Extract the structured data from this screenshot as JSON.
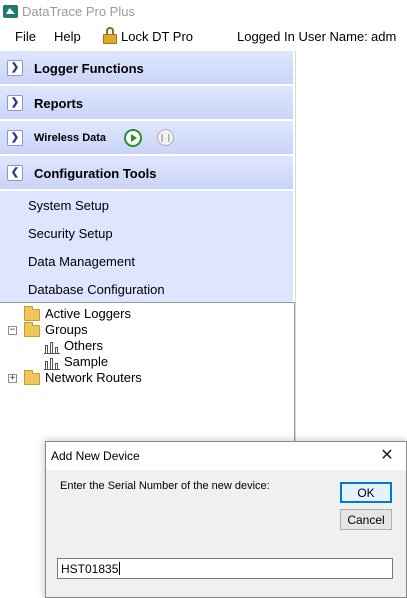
{
  "app": {
    "title": "DataTrace Pro Plus"
  },
  "menubar": {
    "file": "File",
    "help": "Help",
    "lock": "Lock DT Pro",
    "user_label": "Logged In User Name:",
    "user_value": "adm"
  },
  "sidebar": {
    "sections": [
      {
        "label": "Logger Functions",
        "icon": "chevron-double-down-icon"
      },
      {
        "label": "Reports",
        "icon": "chevron-double-down-icon"
      },
      {
        "label": "Wireless Data",
        "icon": "chevron-double-down-icon"
      },
      {
        "label": "Configuration Tools",
        "icon": "chevron-double-up-icon"
      }
    ],
    "config_items": [
      "System Setup",
      "Security Setup",
      "Data Management",
      "Database Configuration"
    ]
  },
  "tree": {
    "nodes": [
      {
        "label": "Active Loggers",
        "icon": "folder-icon"
      },
      {
        "label": "Groups",
        "icon": "folder-icon",
        "expander": "−"
      },
      {
        "label": "Others",
        "icon": "group-icon"
      },
      {
        "label": "Sample",
        "icon": "group-icon"
      },
      {
        "label": "Network Routers",
        "icon": "folder-icon",
        "expander": "+"
      }
    ]
  },
  "dialog": {
    "title": "Add New Device",
    "close": "✕",
    "prompt": "Enter the Serial Number of the new device:",
    "ok_label": "OK",
    "cancel_label": "Cancel",
    "serial_value": "HST01835"
  },
  "colors": {
    "section_header": "#c9d4f7",
    "config_panel": "#dde5ff",
    "play_green": "#2e8b2e",
    "focus_blue": "#0078d7"
  }
}
